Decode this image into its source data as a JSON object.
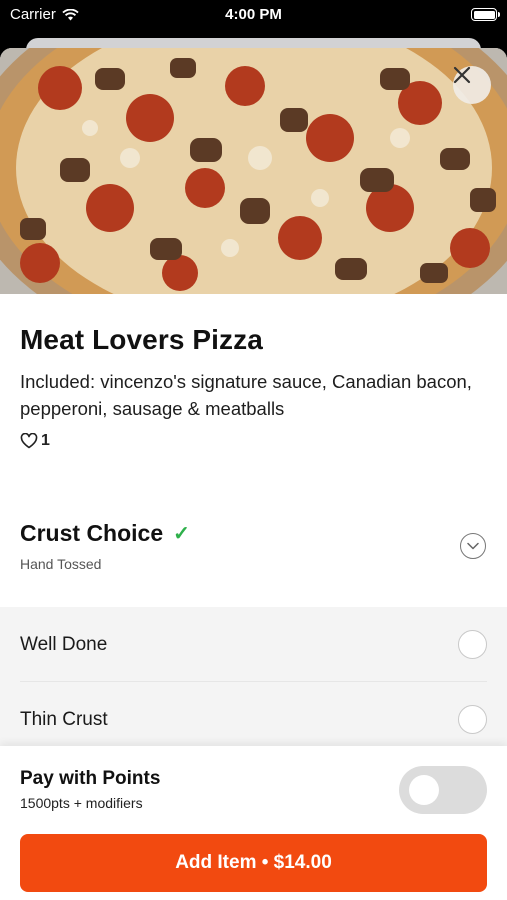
{
  "status_bar": {
    "carrier": "Carrier",
    "time": "4:00 PM"
  },
  "item": {
    "name": "Meat Lovers Pizza",
    "description": "Included: vincenzo's signature sauce, Canadian bacon, pepperoni, sausage & meatballs",
    "likes": "1",
    "image": "pizza-photo"
  },
  "crust": {
    "title": "Crust Choice",
    "check": "✓",
    "selected": "Hand Tossed",
    "options": [
      {
        "label": "Well Done",
        "selected": false
      },
      {
        "label": "Thin Crust",
        "selected": false
      }
    ]
  },
  "points": {
    "title": "Pay with Points",
    "subtitle": "1500pts + modifiers",
    "enabled": false
  },
  "add_button": {
    "label": "Add Item • $14.00"
  },
  "colors": {
    "accent": "#f24a10",
    "check": "#2eb04b"
  }
}
